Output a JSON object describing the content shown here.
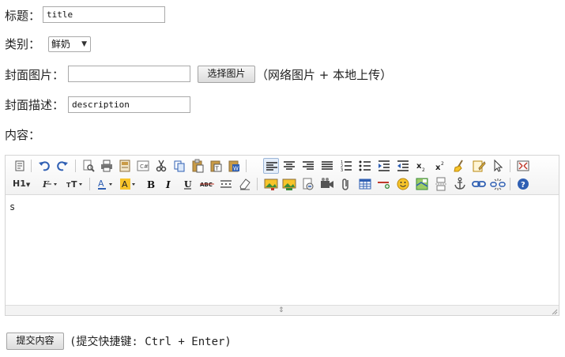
{
  "form": {
    "title_label": "标题：",
    "title_value": "title",
    "category_label": "类别：",
    "category_selected": "鲜奶",
    "cover_label": "封面图片：",
    "cover_value": "",
    "choose_image_button": "选择图片",
    "cover_note": "（网络图片 + 本地上传）",
    "desc_label": "封面描述：",
    "desc_value": "description",
    "content_label": "内容："
  },
  "editor": {
    "heading_label": "H1",
    "content_text": "s",
    "toolbar_icons": [
      "source-icon",
      "undo-icon",
      "redo-icon",
      "preview-icon",
      "print-icon",
      "template-icon",
      "code-icon",
      "cut-icon",
      "copy-icon",
      "paste-icon",
      "paste-text-icon",
      "paste-word-icon",
      "justify-left-icon",
      "justify-center-icon",
      "justify-right-icon",
      "justify-full-icon",
      "ordered-list-icon",
      "unordered-list-icon",
      "indent-icon",
      "outdent-icon",
      "subscript-icon",
      "superscript-icon",
      "clear-format-icon",
      "select-all-icon",
      "fullscreen-icon",
      "heading-icon",
      "font-family-icon",
      "font-size-icon",
      "text-color-icon",
      "highlight-icon",
      "bold-icon",
      "italic-icon",
      "underline-icon",
      "strikethrough-icon",
      "line-height-icon",
      "remove-format-icon",
      "image-icon",
      "multi-image-icon",
      "flash-icon",
      "media-icon",
      "attachment-icon",
      "table-icon",
      "horizontal-line-icon",
      "emoticon-icon",
      "insert-map-icon",
      "page-break-icon",
      "anchor-icon",
      "link-icon",
      "unlink-icon",
      "about-icon"
    ]
  },
  "submit": {
    "button_label": "提交内容",
    "hint": "(提交快捷键: Ctrl + Enter)"
  },
  "colors": {
    "accent_blue": "#2f5fb3",
    "highlight_yellow": "#f7c42a",
    "toolbar_active_border": "#9cb6d8"
  }
}
